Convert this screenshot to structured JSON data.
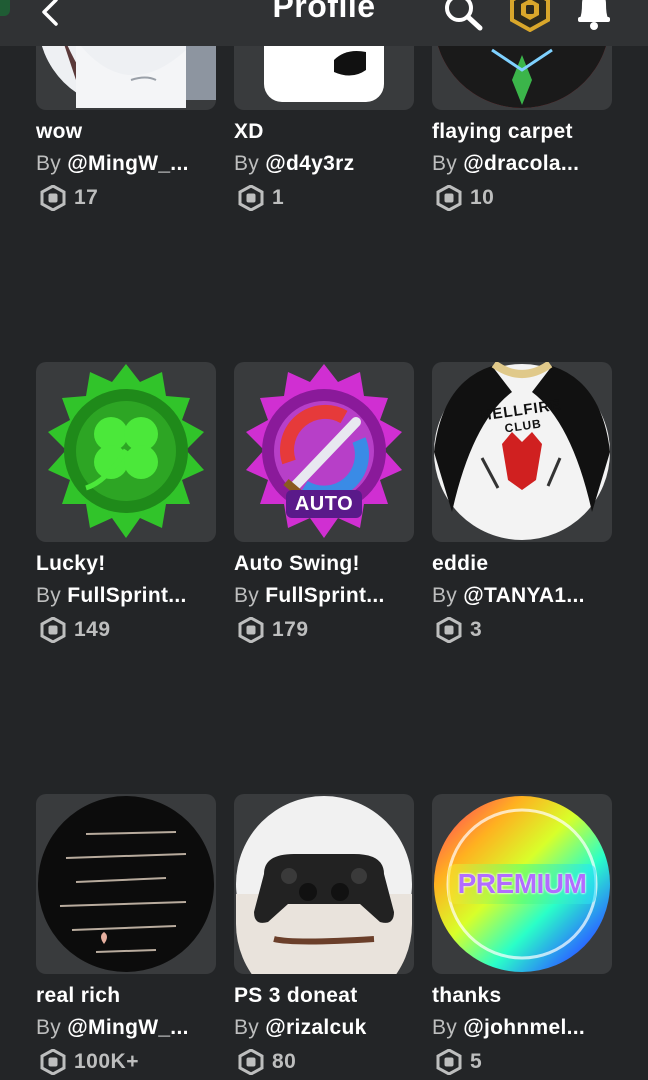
{
  "header": {
    "title": "Profile"
  },
  "items": [
    {
      "name": "wow",
      "by_label": "By",
      "creator": "@MingW_...",
      "price": "17"
    },
    {
      "name": "XD",
      "by_label": "By",
      "creator": "@d4y3rz",
      "price": "1"
    },
    {
      "name": "flaying carpet",
      "by_label": "By",
      "creator": "@dracola...",
      "price": "10"
    },
    {
      "name": "Lucky!",
      "by_label": "By",
      "creator": "FullSprint...",
      "price": "149"
    },
    {
      "name": "Auto Swing!",
      "by_label": "By",
      "creator": "FullSprint...",
      "price": "179"
    },
    {
      "name": "eddie",
      "by_label": "By",
      "creator": "@TANYA1...",
      "price": "3"
    },
    {
      "name": "real rich",
      "by_label": "By",
      "creator": "@MingW_...",
      "price": "100K+"
    },
    {
      "name": "PS 3 doneat",
      "by_label": "By",
      "creator": "@rizalcuk",
      "price": "80"
    },
    {
      "name": "thanks",
      "by_label": "By",
      "creator": "@johnmel...",
      "price": "5"
    }
  ],
  "thumb_text": {
    "auto_badge": "AUTO",
    "hellfire_line1": "HELLFIRE",
    "hellfire_line2": "CLUB",
    "premium_badge": "PREMIUM"
  },
  "icons": {
    "back": "chevron-left-icon",
    "search": "search-icon",
    "robux": "robux-hexagon-icon",
    "bell": "notification-bell-icon"
  },
  "colors": {
    "background": "#232527",
    "header": "#303234",
    "card": "#393b3d",
    "muted_text": "#bdbebe"
  }
}
